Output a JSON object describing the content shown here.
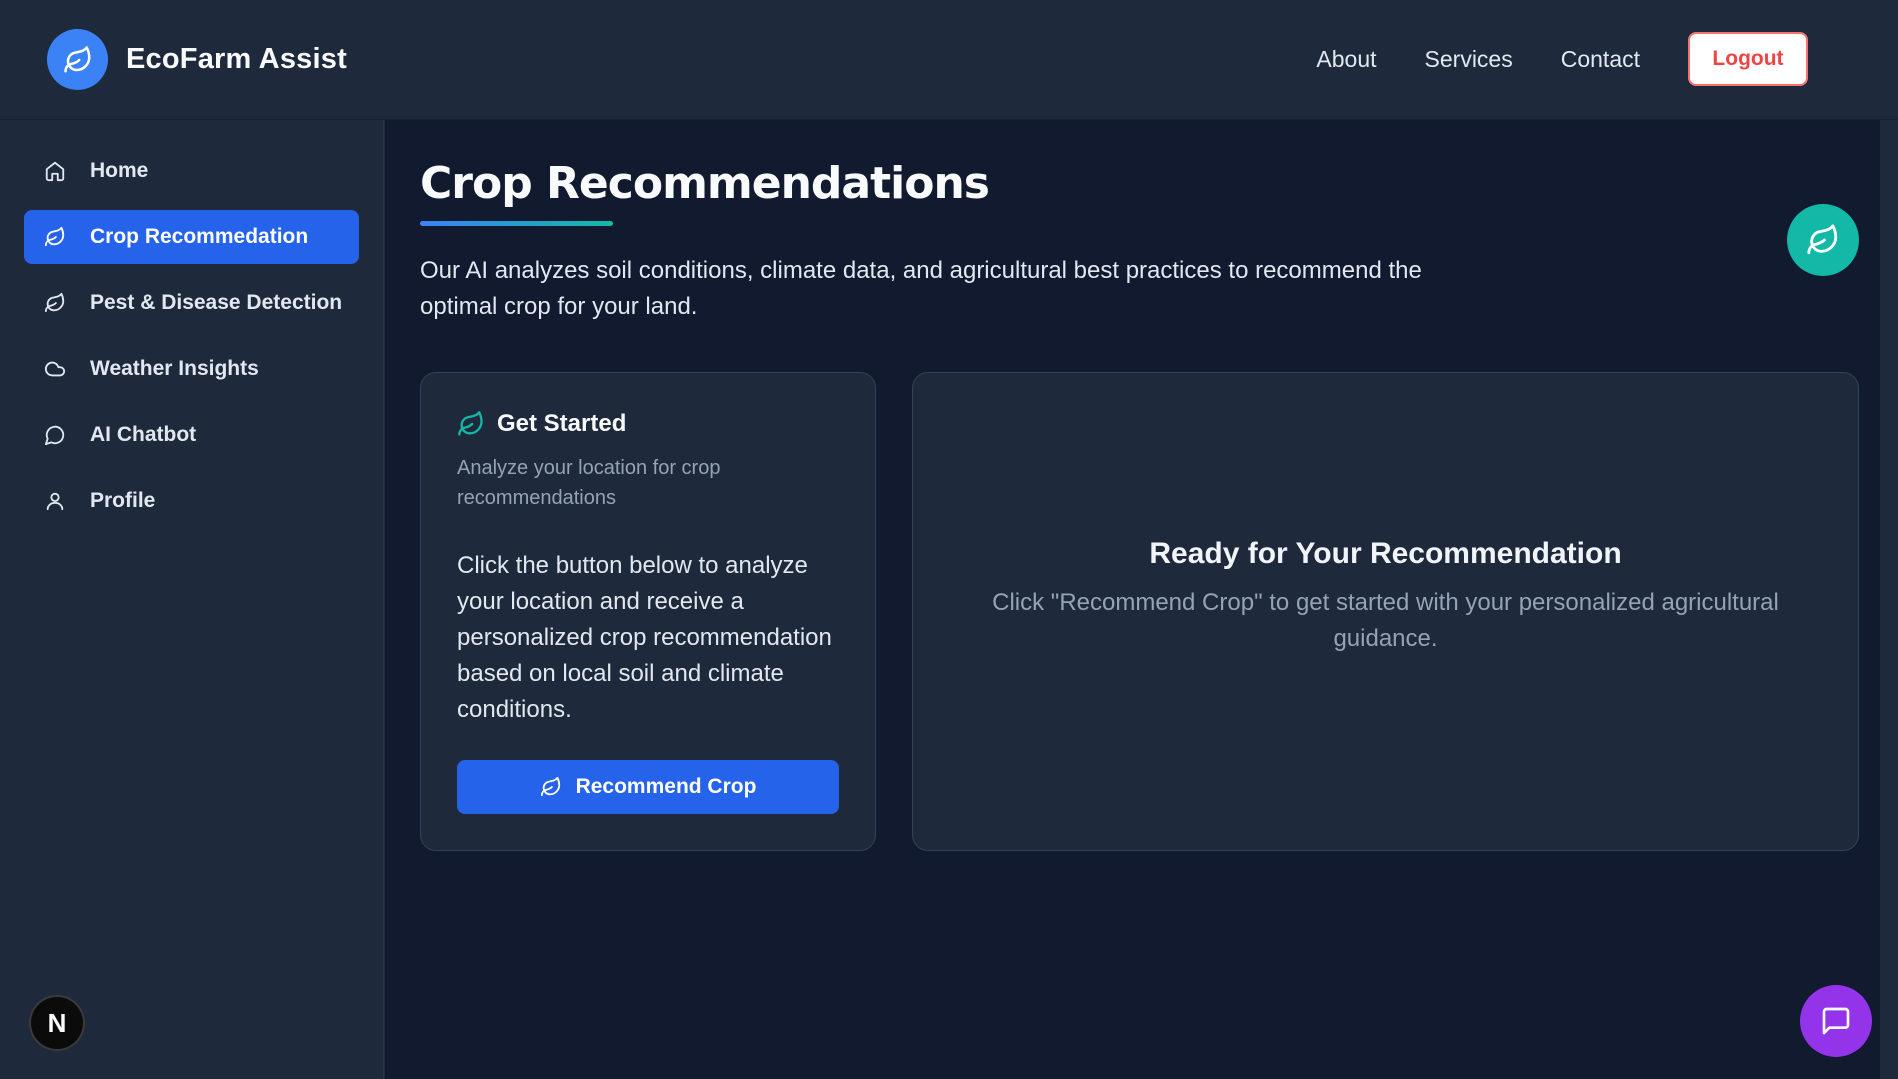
{
  "brand": {
    "name": "EcoFarm Assist"
  },
  "topnav": {
    "about": "About",
    "services": "Services",
    "contact": "Contact",
    "logout": "Logout"
  },
  "sidebar": {
    "items": [
      {
        "label": "Home",
        "icon": "home-icon"
      },
      {
        "label": "Crop Recommedation",
        "icon": "leaf-icon",
        "active": true
      },
      {
        "label": "Pest & Disease Detection",
        "icon": "leaf-icon"
      },
      {
        "label": "Weather Insights",
        "icon": "cloud-icon"
      },
      {
        "label": "AI Chatbot",
        "icon": "chat-bubble-icon"
      },
      {
        "label": "Profile",
        "icon": "user-icon"
      }
    ],
    "badge": "N"
  },
  "main": {
    "title": "Crop Recommendations",
    "intro": "Our AI analyzes soil conditions, climate data, and agricultural best practices to recommend the optimal crop for your land.",
    "get_started": {
      "title": "Get Started",
      "subtitle": "Analyze your location for crop recommendations",
      "body": "Click the button below to analyze your location and receive a personalized crop recommendation based on local soil and climate conditions.",
      "button": "Recommend Crop"
    },
    "ready": {
      "title": "Ready for Your Recommendation",
      "text": "Click \"Recommend Crop\" to get started with your personalized agricultural guidance."
    }
  },
  "colors": {
    "accent": "#2563eb",
    "teal": "#14b8a6",
    "purple": "#9333ea",
    "logout_red": "#ef4444"
  }
}
